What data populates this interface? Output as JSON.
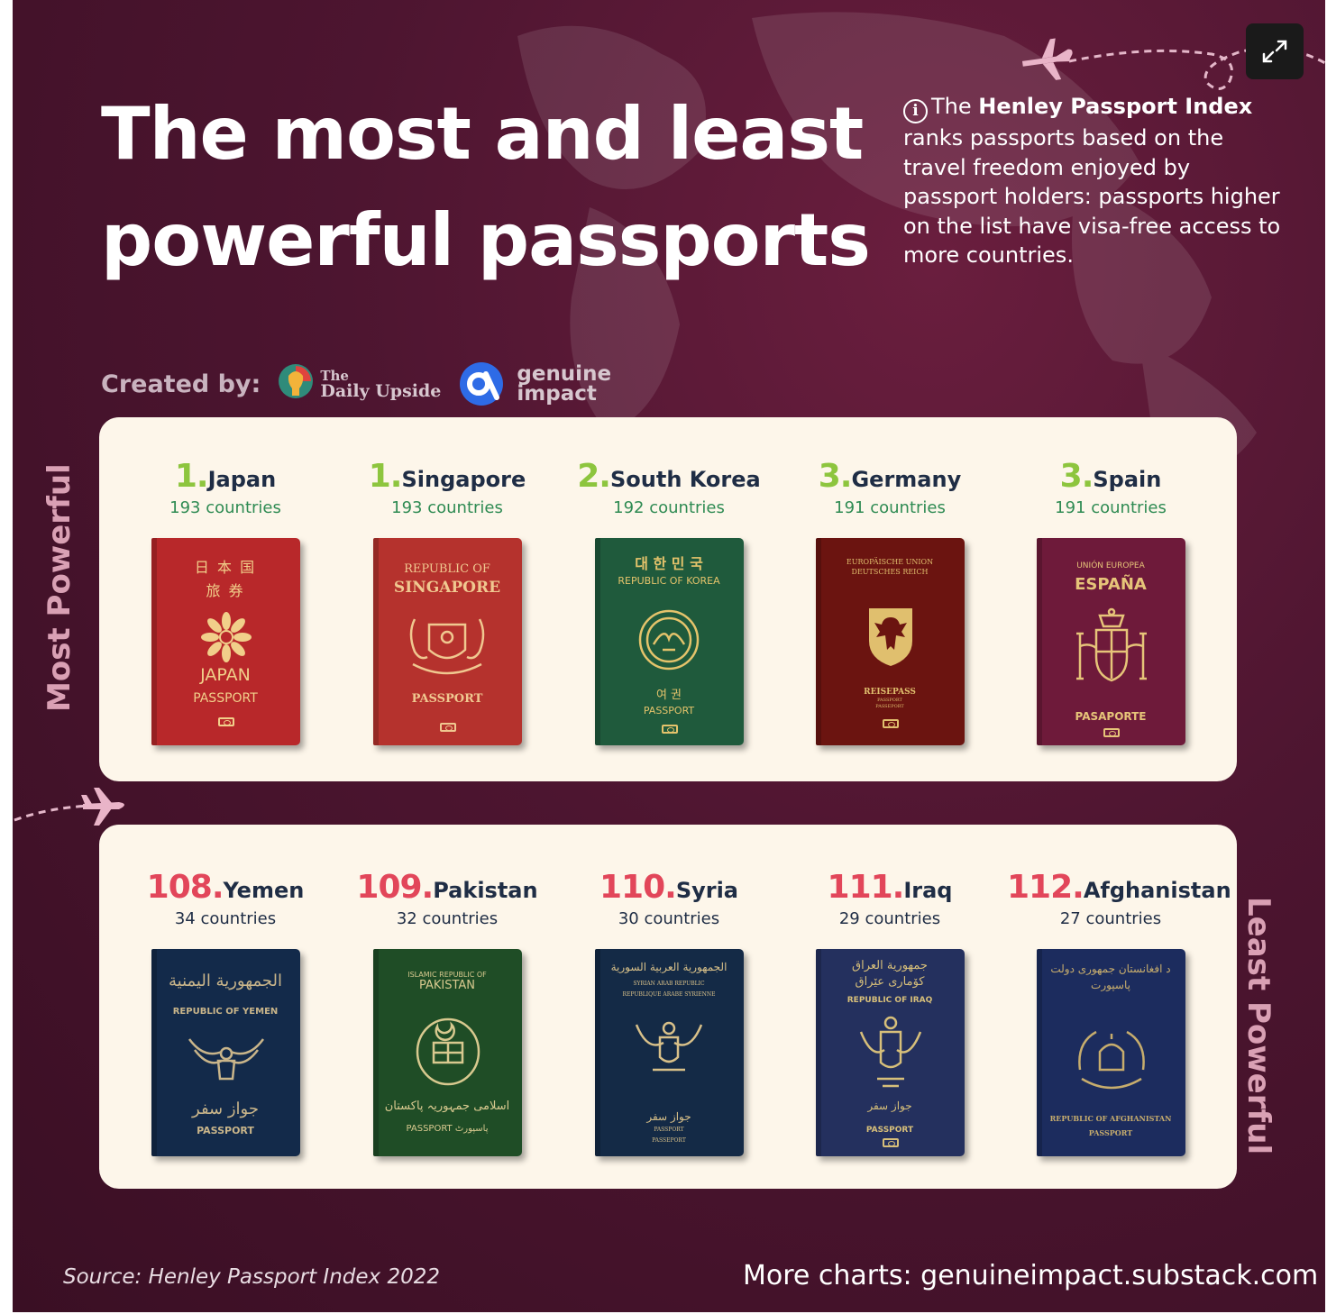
{
  "title": {
    "line1": "The most and least",
    "line2": "powerful passports"
  },
  "info": {
    "pre": "The",
    "highlight": "Henley Passport Index",
    "post": "ranks passports based on the travel freedom enjoyed by passport holders: passports higher on the list have visa-free access to more countries."
  },
  "credits": {
    "label": "Created by:",
    "daily_upside_a": "The",
    "daily_upside_b": "Daily Upside",
    "genuine_a": "genuine",
    "genuine_b": "impact"
  },
  "labels": {
    "most": "Most Powerful",
    "least": "Least Powerful"
  },
  "most_powerful": [
    {
      "rank": "1.",
      "country": "Japan",
      "countries": "193 countries",
      "cover_color": "#b8282a",
      "ink": "#f1cf8a",
      "lines": [
        "日  本  国",
        "旅      券",
        "JAPAN",
        "PASSPORT"
      ]
    },
    {
      "rank": "1.",
      "country": "Singapore",
      "countries": "193 countries",
      "cover_color": "#b5322d",
      "ink": "#f0c890",
      "lines": [
        "REPUBLIC OF",
        "SINGAPORE",
        "PASSPORT"
      ]
    },
    {
      "rank": "2.",
      "country": "South Korea",
      "countries": "192 countries",
      "cover_color": "#1f5a3c",
      "ink": "#e4c36b",
      "lines": [
        "대 한 민 국",
        "REPUBLIC OF KOREA",
        "여  권",
        "PASSPORT"
      ]
    },
    {
      "rank": "3.",
      "country": "Germany",
      "countries": "191 countries",
      "cover_color": "#6b1410",
      "ink": "#e0bf6e",
      "lines": [
        "EUROPÄISCHE UNION",
        "DEUTSCHES REICH",
        "REISEPASS",
        "PASSPORT",
        "PASSEPORT"
      ]
    },
    {
      "rank": "3.",
      "country": "Spain",
      "countries": "191 countries",
      "cover_color": "#6e1a3a",
      "ink": "#e6c479",
      "lines": [
        "UNIÓN EUROPEA",
        "ESPAÑA",
        "PASAPORTE"
      ]
    }
  ],
  "least_powerful": [
    {
      "rank": "108.",
      "country": "Yemen",
      "countries": "34 countries",
      "cover_color": "#132a4a",
      "ink": "#c9b58a",
      "lines": [
        "الجمهورية اليمنية",
        "REPUBLIC OF YEMEN",
        "جواز سفر",
        "PASSPORT"
      ]
    },
    {
      "rank": "109.",
      "country": "Pakistan",
      "countries": "32 countries",
      "cover_color": "#1f4d26",
      "ink": "#d8c98f",
      "lines": [
        "ISLAMIC REPUBLIC OF",
        "PAKISTAN",
        "اسلامی جمہوریہ پاکستان",
        "PASSPORT پاسپورٹ"
      ]
    },
    {
      "rank": "110.",
      "country": "Syria",
      "countries": "30 countries",
      "cover_color": "#142a46",
      "ink": "#d8c089",
      "lines": [
        "الجمهورية العربية السورية",
        "SYRIAN ARAB REPUBLIC",
        "REPUBLIQUE ARABE SYRIENNE",
        "جواز سفر",
        "PASSPORT",
        "PASSEPORT"
      ]
    },
    {
      "rank": "111.",
      "country": "Iraq",
      "countries": "29 countries",
      "cover_color": "#24305e",
      "ink": "#d7bf7a",
      "lines": [
        "جمهورية العراق",
        "كۆماری عێراق",
        "REPUBLIC OF IRAQ",
        "جواز سفر",
        "PASSPORT"
      ]
    },
    {
      "rank": "112.",
      "country": "Afghanistan",
      "countries": "27 countries",
      "cover_color": "#1c2c5e",
      "ink": "#c7ad6d",
      "lines": [
        "د افغانستان جمهوری دولت",
        "پاسپورت",
        "REPUBLIC OF AFGHANISTAN",
        "PASSPORT"
      ]
    }
  ],
  "footer": {
    "source": "Source: Henley Passport Index 2022",
    "more": "More charts: genuineimpact.substack.com"
  }
}
